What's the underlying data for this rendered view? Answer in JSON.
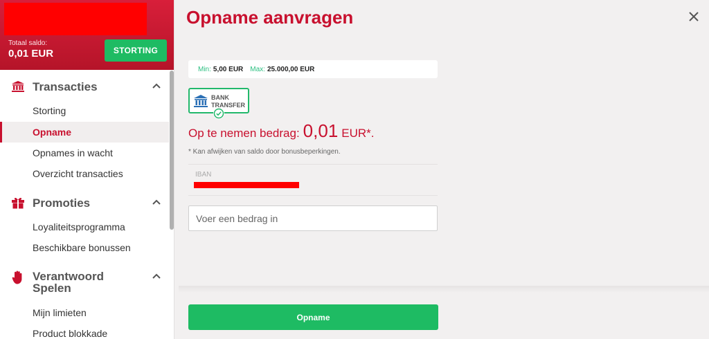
{
  "sidebar": {
    "total_label": "Totaal saldo:",
    "total_value": "0,01 EUR",
    "deposit_button": "STORTING",
    "sections": [
      {
        "title": "Transacties",
        "icon": "bank-icon",
        "items": [
          "Storting",
          "Opname",
          "Opnames in wacht",
          "Overzicht transacties"
        ],
        "active_item": "Opname"
      },
      {
        "title": "Promoties",
        "icon": "gift-icon",
        "items": [
          "Loyaliteitsprogramma",
          "Beschikbare bonussen"
        ]
      },
      {
        "title": "Verantwoord\nSpelen",
        "icon": "hand-stop-icon",
        "items": [
          "Mijn limieten",
          "Product blokkade"
        ]
      }
    ]
  },
  "main": {
    "title": "Opname aanvragen",
    "limits": {
      "min_label": "Min:",
      "min_value": "5,00 EUR",
      "max_label": "Max:",
      "max_value": "25.000,00 EUR"
    },
    "method": {
      "line1": "BANK",
      "line2": "TRANSFER",
      "selected": true
    },
    "amount": {
      "label": "Op te nemen bedrag:",
      "value": "0,01",
      "currency": "EUR*."
    },
    "note": "* Kan afwijken van saldo door bonusbeperkingen.",
    "iban_label": "IBAN",
    "input_placeholder": "Voer een bedrag in",
    "withdraw_button": "Opname"
  },
  "colors": {
    "brand_red": "#c8102e",
    "action_green": "#1ebb63",
    "accent_green": "#2bbf80"
  }
}
